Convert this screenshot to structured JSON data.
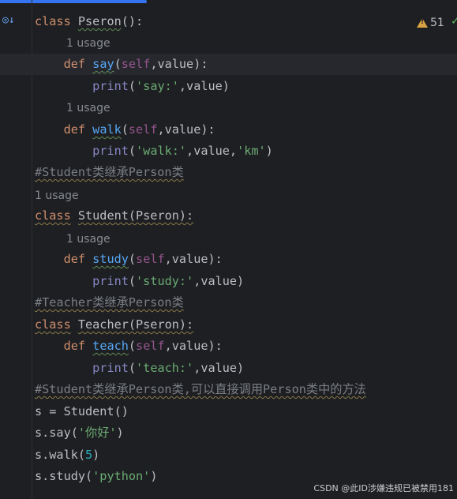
{
  "inspection": {
    "warning_count": "51"
  },
  "code": {
    "l1": {
      "kw": "class",
      "name": "Pseron",
      "rest": "():"
    },
    "hint1": "1 usage",
    "l2": {
      "kw": "def",
      "name": "say",
      "open": "(",
      "self": "self",
      "rest": ",value):"
    },
    "l3": {
      "fn": "print",
      "open": "(",
      "str": "'say:'",
      "rest": ",value)"
    },
    "hint2": "1 usage",
    "l4": {
      "kw": "def",
      "name": "walk",
      "open": "(",
      "self": "self",
      "rest": ",value):"
    },
    "l5": {
      "fn": "print",
      "open": "(",
      "str1": "'walk:'",
      "mid": ",value,",
      "str2": "'km'",
      "close": ")"
    },
    "l6": {
      "comment": "#Student类继承Person类"
    },
    "hint3": "1 usage",
    "l7": {
      "kw": "class",
      "rest": "Student(Pseron):"
    },
    "hint4": "1 usage",
    "l8": {
      "kw": "def",
      "name": "study",
      "open": "(",
      "self": "self",
      "rest": ",value):"
    },
    "l9": {
      "fn": "print",
      "open": "(",
      "str": "'study:'",
      "rest": ",value)"
    },
    "l10": {
      "comment": "#Teacher类继承Person类"
    },
    "l11": {
      "kw": "class",
      "rest": "Teacher(Pseron):"
    },
    "l12": {
      "kw": "def",
      "name": "teach",
      "open": "(",
      "self": "self",
      "rest": ",value):"
    },
    "l13": {
      "fn": "print",
      "open": "(",
      "str": "'teach:'",
      "rest": ",value)"
    },
    "l14": {
      "comment": "#Student类继承Person类,可以直接调用Person类中的方法"
    },
    "l15": {
      "text": "s = Student()"
    },
    "l16": {
      "pre": "s.say(",
      "str": "'你好'",
      "post": ")"
    },
    "l17": {
      "pre": "s.walk(",
      "num": "5",
      "post": ")"
    },
    "l18": {
      "pre": "s.study(",
      "str": "'python'",
      "post": ")"
    }
  },
  "watermark": "CSDN @此ID涉嫌违规已被禁用181"
}
